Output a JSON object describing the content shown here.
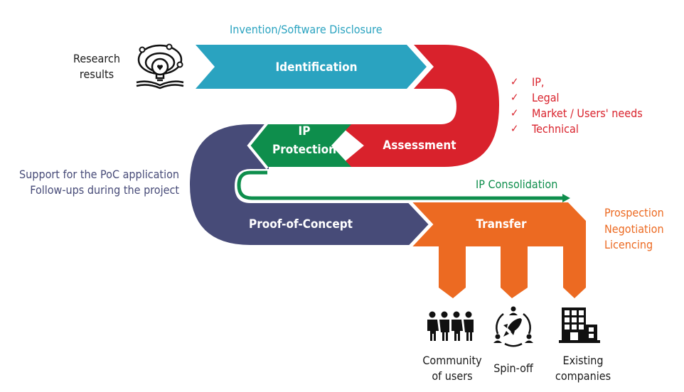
{
  "diagram": {
    "start": {
      "label_lines": [
        "Research",
        "results"
      ],
      "icon": "lightbulb-book-icon"
    },
    "annotations": {
      "disclosure": "Invention/Software Disclosure",
      "ip_consolidation": "IP Consolidation",
      "poc_support": [
        "Support for the PoC application",
        "Follow-ups during the project"
      ],
      "transfer_activities": [
        "Prospection",
        "Negotiation",
        "Licencing"
      ]
    },
    "assessment_checklist": [
      {
        "check": "✓",
        "label": "IP,"
      },
      {
        "check": "✓",
        "label": "Legal"
      },
      {
        "check": "✓",
        "label": "Market / Users' needs"
      },
      {
        "check": "✓",
        "label": "Technical"
      }
    ],
    "stages": [
      {
        "id": "identification",
        "label": "Identification",
        "color": "#2aa3c0"
      },
      {
        "id": "assessment",
        "label": "Assessment",
        "color": "#d9222c"
      },
      {
        "id": "ip-protection",
        "label_lines": [
          "IP",
          "Protection"
        ],
        "color": "#0e8e4c"
      },
      {
        "id": "proof-of-concept",
        "label": "Proof-of-Concept",
        "color": "#474b78"
      },
      {
        "id": "transfer",
        "label": "Transfer",
        "color": "#ec6a22"
      }
    ],
    "outcomes": [
      {
        "icon": "community-users-icon",
        "label_lines": [
          "Community",
          "of users"
        ]
      },
      {
        "icon": "spin-off-rocket-icon",
        "label_lines": [
          "Spin-off"
        ]
      },
      {
        "icon": "existing-companies-building-icon",
        "label_lines": [
          "Existing",
          "companies"
        ]
      }
    ]
  }
}
